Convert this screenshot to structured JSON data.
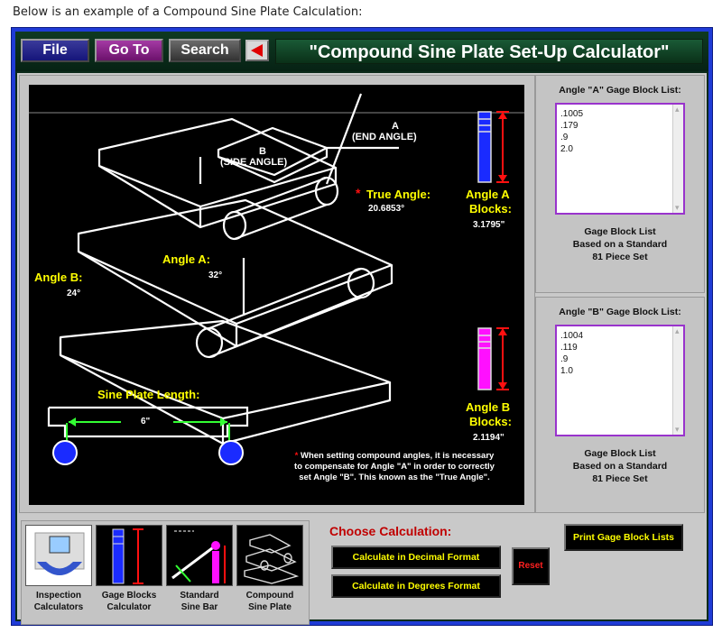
{
  "caption": "Below is an example of a Compound Sine Plate Calculation:",
  "menu": {
    "file": "File",
    "goto": "Go To",
    "search": "Search"
  },
  "app_title": "\"Compound Sine Plate Set-Up Calculator\"",
  "diagram": {
    "label_a": "A",
    "end_angle": "(END ANGLE)",
    "label_b": "B",
    "side_angle": "(SIDE ANGLE)",
    "true_angle_star": "*",
    "true_angle_label": "True Angle:",
    "true_angle_value": "20.6853°",
    "angle_a_label": "Angle A:",
    "angle_a_value": "32°",
    "angle_b_label": "Angle B:",
    "angle_b_value": "24°",
    "plate_length_label": "Sine Plate Length:",
    "plate_length_value": "6\"",
    "angle_a_blocks_line1": "Angle A",
    "angle_a_blocks_line2": "Blocks:",
    "angle_a_blocks_value": "3.1795\"",
    "angle_b_blocks_line1": "Angle B",
    "angle_b_blocks_line2": "Blocks:",
    "angle_b_blocks_value": "2.1194\"",
    "note_star": "*",
    "note_text": "When setting compound angles, it is necessary to compensate for Angle \"A\" in order to correctly set Angle \"B\". This known as the \"True Angle\"."
  },
  "list_a": {
    "title": "Angle \"A\" Gage Block List:",
    "items": [
      ".1005",
      ".179",
      ".9",
      "2.0"
    ],
    "foot1": "Gage Block List",
    "foot2": "Based on a Standard",
    "foot3": "81 Piece Set"
  },
  "list_b": {
    "title": "Angle \"B\" Gage Block List:",
    "items": [
      ".1004",
      ".119",
      ".9",
      "1.0"
    ],
    "foot1": "Gage Block List",
    "foot2": "Based on a Standard",
    "foot3": "81 Piece Set"
  },
  "nav": [
    {
      "line1": "Inspection",
      "line2": "Calculators",
      "icon": "magnifier-icon"
    },
    {
      "line1": "Gage Blocks",
      "line2": "Calculator",
      "icon": "gage-blocks-icon"
    },
    {
      "line1": "Standard",
      "line2": "Sine Bar",
      "icon": "sine-bar-icon"
    },
    {
      "line1": "Compound",
      "line2": "Sine Plate",
      "icon": "compound-plate-icon"
    }
  ],
  "choose_title": "Choose Calculation:",
  "buttons": {
    "decimal": "Calculate in Decimal Format",
    "degrees": "Calculate in Degrees Format",
    "reset": "Reset",
    "print": "Print Gage Block Lists"
  },
  "colors": {
    "frame": "#1f3bd6",
    "accent_yellow": "#ffff00",
    "accent_red": "#ff1010",
    "list_border": "#9933cc"
  }
}
